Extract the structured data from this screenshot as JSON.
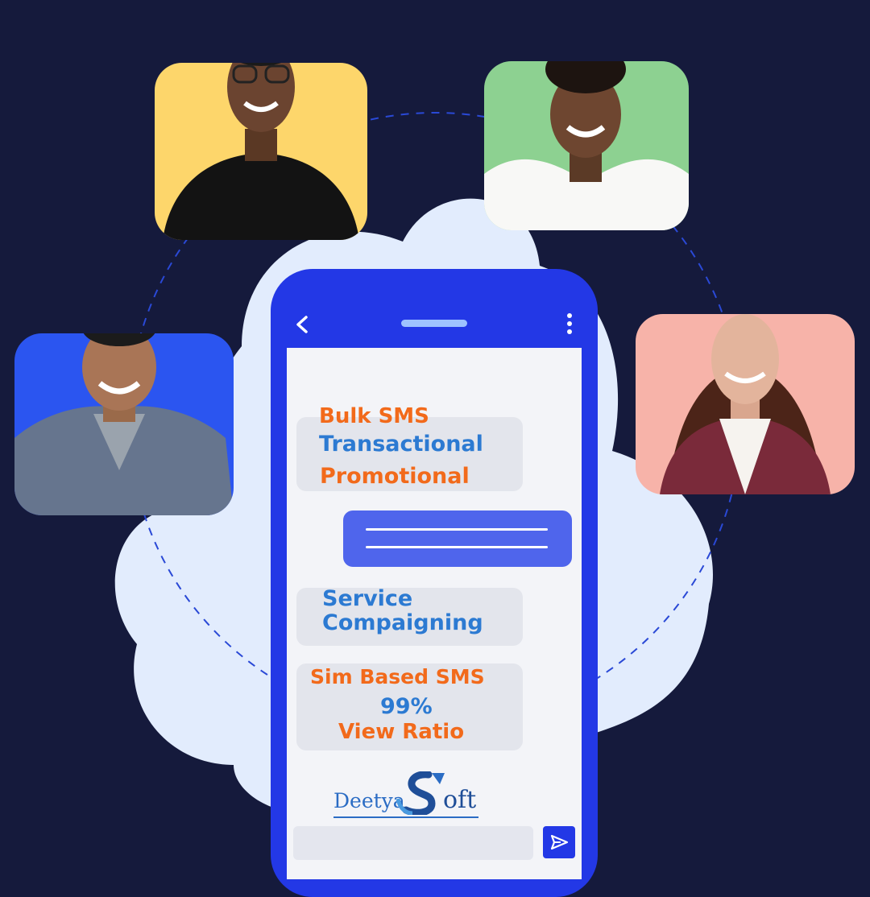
{
  "messages": {
    "bubble1": {
      "line1": "Bulk SMS",
      "line2": "Transactional",
      "line3": "Promotional"
    },
    "bubble3": {
      "line1": "Service",
      "line2": "Compaigning"
    },
    "bubble4": {
      "line1": "Sim Based SMS",
      "line2": "99%",
      "line3": "View Ratio"
    }
  },
  "logo": {
    "part1": "Deetya",
    "part2": "oft"
  },
  "colors": {
    "background": "#151a3c",
    "phone": "#2338e6",
    "orange_text": "#f26a1b",
    "blue_text": "#2c7ad2",
    "card_yellow": "#fdd66b",
    "card_green": "#8dd191",
    "card_blue": "#2b55f0",
    "card_pink": "#f7b3a9"
  },
  "icons": [
    "back-arrow-icon",
    "more-vertical-icon",
    "send-icon"
  ]
}
